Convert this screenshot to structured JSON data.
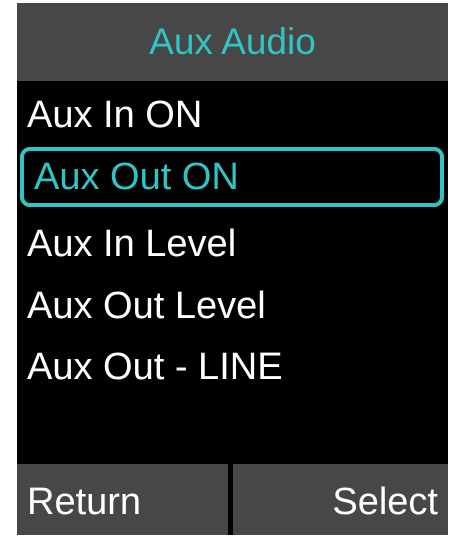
{
  "header": {
    "title": "Aux Audio"
  },
  "menu": {
    "items": [
      {
        "label": "Aux In ON"
      },
      {
        "label": "Aux Out ON"
      },
      {
        "label": "Aux In Level"
      },
      {
        "label": "Aux Out Level"
      },
      {
        "label": "Aux Out - LINE"
      }
    ],
    "selected_index": 1
  },
  "softkeys": {
    "left_label": "Return",
    "right_label": "Select"
  },
  "colors": {
    "accent": "#31c4c4",
    "bar_background": "#474747",
    "screen_background": "#000000",
    "text": "#ffffff"
  }
}
